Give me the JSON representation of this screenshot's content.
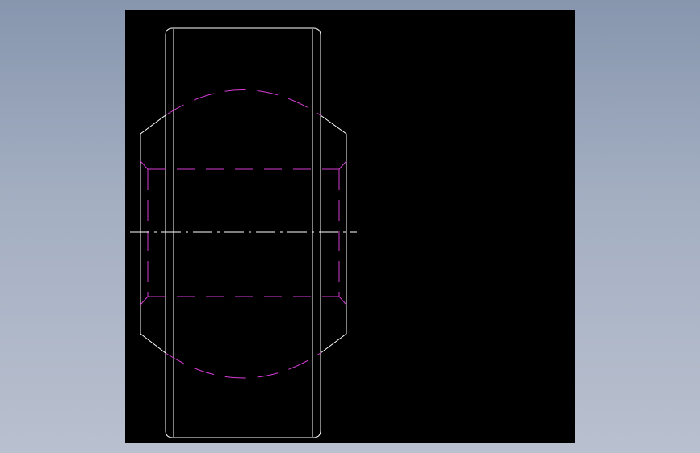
{
  "colors": {
    "background_gradient_top": "#8796ae",
    "background_gradient_bottom": "#b9c0cf",
    "viewport": "#000000",
    "outline": "#ffffff",
    "hidden_lines": "#d43cd4",
    "centerline": "#ffffff"
  }
}
